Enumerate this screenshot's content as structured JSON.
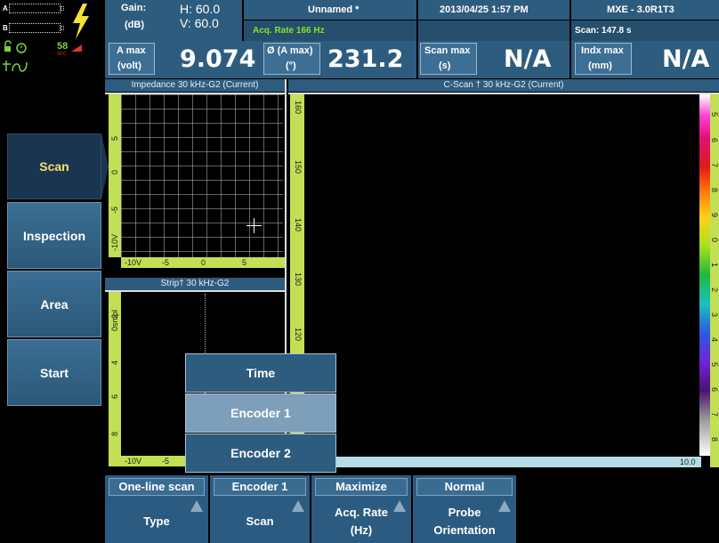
{
  "status": {
    "battery_a": "A",
    "battery_b": "B",
    "temperature": "58",
    "temperature_unit": "IN°C"
  },
  "header": {
    "gain_label": "Gain:",
    "gain_unit": "(dB)",
    "gain_h": "H: 60.0",
    "gain_v": "V: 60.0",
    "file_name": "Unnamed *",
    "acq_rate": "Acq. Rate 166  Hz",
    "datetime": "2013/04/25 1:57 PM",
    "device": "MXE - 3.0R1T3",
    "scan_time": "Scan:  147.8 s"
  },
  "readings": {
    "amax_label": "A max",
    "amax_unit": "(volt)",
    "amax_value": "9.074",
    "phase_label": "Ø (A max)",
    "phase_unit": "(°)",
    "phase_value": "231.2",
    "scanmax_label": "Scan max",
    "scanmax_unit": "(s)",
    "scanmax_value": "N/A",
    "indxmax_label": "Indx max",
    "indxmax_unit": "(mm)",
    "indxmax_value": "N/A"
  },
  "menu": {
    "items": [
      {
        "label": "Scan",
        "active": true
      },
      {
        "label": "Inspection",
        "active": false
      },
      {
        "label": "Area",
        "active": false
      },
      {
        "label": "Start",
        "active": false
      }
    ]
  },
  "impedance": {
    "title": "Impedance 30 kHz-G2 (Current)",
    "y_ticks": [
      "5",
      "0",
      "-5",
      "-10V"
    ],
    "x_ticks": [
      "-10V",
      "-5",
      "0",
      "5"
    ]
  },
  "strip": {
    "title": "Strip† 30 kHz-G2",
    "y_ticks": [
      "0smpl",
      "2",
      "4",
      "6",
      "8"
    ],
    "x_ticks": [
      "-10V",
      "-5"
    ]
  },
  "cscan": {
    "title": "C-Scan † 30 kHz-G2 (Current)",
    "y_ticks": [
      "160",
      "150",
      "140",
      "130",
      "120"
    ],
    "x_end": "10.0",
    "color_ticks": [
      "5",
      "6",
      "7",
      "8",
      "9",
      "0",
      "1",
      "2",
      "3",
      "4",
      "5",
      "6",
      "7",
      "8"
    ]
  },
  "popup": {
    "options": [
      {
        "label": "Time",
        "selected": false
      },
      {
        "label": "Encoder 1",
        "selected": true
      },
      {
        "label": "Encoder 2",
        "selected": false
      }
    ]
  },
  "params": [
    {
      "value": "One-line scan",
      "label1": "Type",
      "label2": ""
    },
    {
      "value": "Encoder 1",
      "label1": "Scan",
      "label2": ""
    },
    {
      "value": "Maximize",
      "label1": "Acq. Rate",
      "label2": "(Hz)"
    },
    {
      "value": "Normal",
      "label1": "Probe",
      "label2": "Orientation"
    }
  ],
  "colors": {
    "panel_blue": "#2e5c7e",
    "ruler_green": "#c2df55",
    "accent_green": "#88e02a",
    "lightning_yellow": "#f3e13a",
    "active_text": "#f3e36a"
  }
}
